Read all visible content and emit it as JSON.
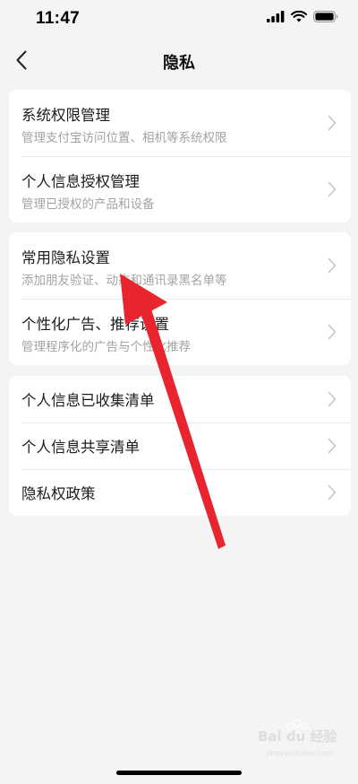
{
  "status_bar": {
    "time": "11:47",
    "icons": [
      "signal-icon",
      "wifi-icon",
      "battery-icon"
    ]
  },
  "nav": {
    "title": "隐私",
    "back_icon": "chevron-left-icon"
  },
  "sections": [
    {
      "items": [
        {
          "title": "系统权限管理",
          "subtitle": "管理支付宝访问位置、相机等系统权限"
        },
        {
          "title": "个人信息授权管理",
          "subtitle": "管理已授权的产品和设备"
        }
      ]
    },
    {
      "items": [
        {
          "title": "常用隐私设置",
          "subtitle": "添加朋友验证、动态和通讯录黑名单等"
        },
        {
          "title": "个性化广告、推荐设置",
          "subtitle": "管理程序化的广告与个性化推荐"
        }
      ]
    },
    {
      "items": [
        {
          "title": "个人信息已收集清单"
        },
        {
          "title": "个人信息共享清单"
        },
        {
          "title": "隐私权政策"
        }
      ]
    }
  ],
  "annotation": {
    "color": "#e8242f"
  },
  "watermark": {
    "text": "Bai du 经验",
    "subtext": "jingyan.baidu.com"
  },
  "colors": {
    "background": "#f4f4f4",
    "card": "#ffffff",
    "title_text": "#1c1c1c",
    "subtitle_text": "#a3a3a3",
    "chevron": "#c4c4c4"
  }
}
